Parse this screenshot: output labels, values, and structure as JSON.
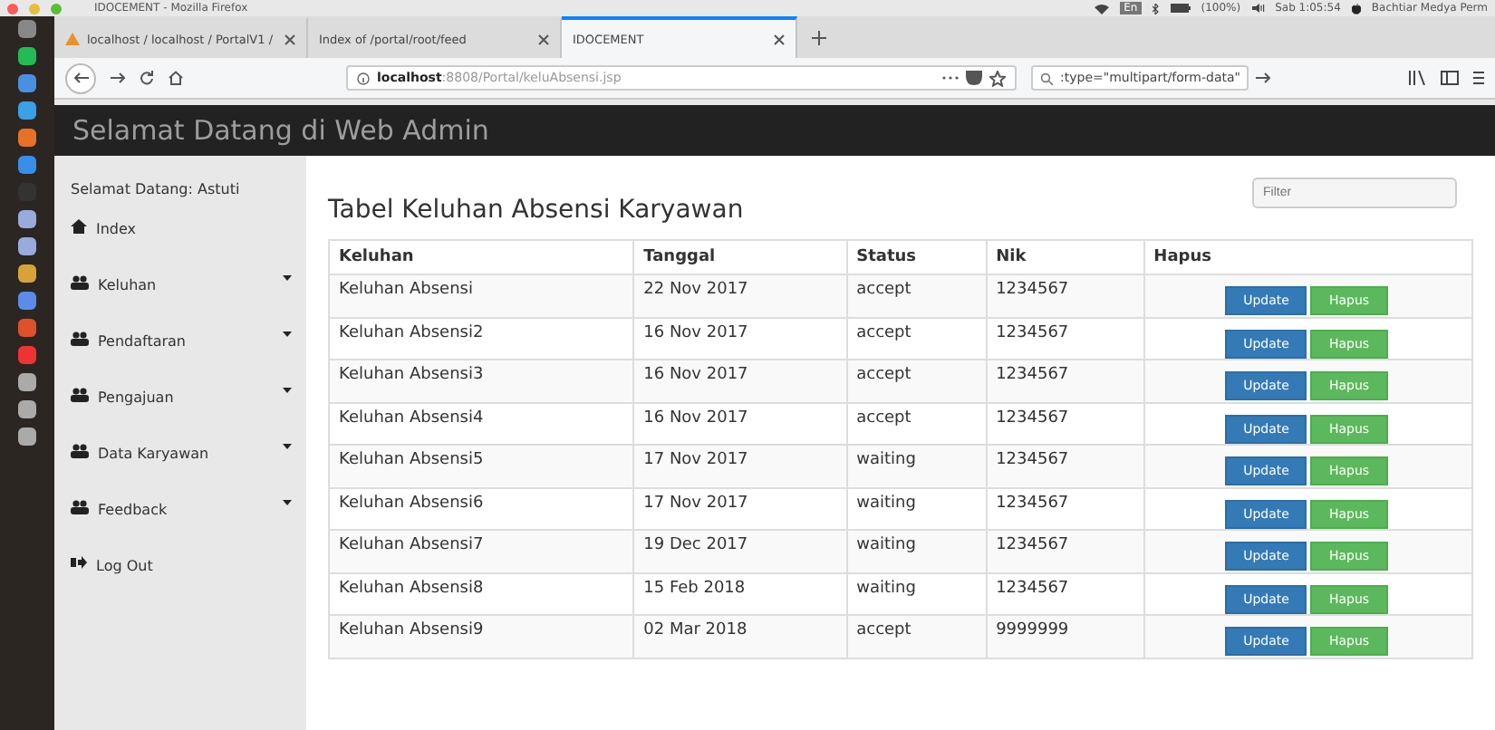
{
  "system_bar": {
    "window_title": "IDOCEMENT - Mozilla Firefox",
    "language": "En",
    "battery": "(100%)",
    "clock": "Sab 1:05:54",
    "user": "Bachtiar Medya Perm"
  },
  "browser_tabs": [
    {
      "label": "localhost / localhost / PortalV1 /",
      "selected": false
    },
    {
      "label": "Index of /portal/root/feed",
      "selected": false
    },
    {
      "label": "IDOCEMENT",
      "selected": true
    }
  ],
  "address_bar": {
    "host": "localhost",
    "path": ":8808/Portal/keluAbsensi.jsp",
    "search": ":type=\"multipart/form-data\""
  },
  "header": {
    "title": "Selamat Datang di Web Admin"
  },
  "sidebar": {
    "greeting": "Selamat Datang: Astuti",
    "items": [
      {
        "label": "Index",
        "kind": "home",
        "expandable": false
      },
      {
        "label": "Keluhan",
        "kind": "group",
        "expandable": true
      },
      {
        "label": "Pendaftaran",
        "kind": "group",
        "expandable": true
      },
      {
        "label": "Pengajuan",
        "kind": "group",
        "expandable": true
      },
      {
        "label": "Data Karyawan",
        "kind": "group",
        "expandable": true
      },
      {
        "label": "Feedback",
        "kind": "group",
        "expandable": true
      },
      {
        "label": "Log Out",
        "kind": "logout",
        "expandable": false
      }
    ]
  },
  "content": {
    "title": "Tabel Keluhan Absensi Karyawan",
    "filter_placeholder": "Filter",
    "table": {
      "columns": [
        "Keluhan",
        "Tanggal",
        "Status",
        "Nik",
        "Hapus"
      ],
      "rows": [
        {
          "keluhan": "Keluhan Absensi",
          "tanggal": "22 Nov 2017",
          "status": "accept",
          "nik": "1234567",
          "actions": [
            "Update",
            "Hapus"
          ]
        },
        {
          "keluhan": "Keluhan Absensi2",
          "tanggal": "16 Nov 2017",
          "status": "accept",
          "nik": "1234567",
          "actions": [
            "Update",
            "Hapus"
          ]
        },
        {
          "keluhan": "Keluhan Absensi3",
          "tanggal": "16 Nov 2017",
          "status": "accept",
          "nik": "1234567",
          "actions": [
            "Update",
            "Hapus"
          ]
        },
        {
          "keluhan": "Keluhan Absensi4",
          "tanggal": "16 Nov 2017",
          "status": "accept",
          "nik": "1234567",
          "actions": [
            "Update",
            "Hapus"
          ]
        },
        {
          "keluhan": "Keluhan Absensi5",
          "tanggal": "17 Nov 2017",
          "status": "waiting",
          "nik": "1234567",
          "actions": [
            "Update",
            "Hapus"
          ]
        },
        {
          "keluhan": "Keluhan Absensi6",
          "tanggal": "17 Nov 2017",
          "status": "waiting",
          "nik": "1234567",
          "actions": [
            "Update",
            "Hapus"
          ]
        },
        {
          "keluhan": "Keluhan Absensi7",
          "tanggal": "19 Dec 2017",
          "status": "waiting",
          "nik": "1234567",
          "actions": [
            "Update",
            "Hapus"
          ]
        },
        {
          "keluhan": "Keluhan Absensi8",
          "tanggal": "15 Feb 2018",
          "status": "waiting",
          "nik": "1234567",
          "actions": [
            "Update",
            "Hapus"
          ]
        },
        {
          "keluhan": "Keluhan Absensi9",
          "tanggal": "02 Mar 2018",
          "status": "accept",
          "nik": "9999999",
          "actions": [
            "Update",
            "Hapus"
          ]
        }
      ]
    }
  }
}
